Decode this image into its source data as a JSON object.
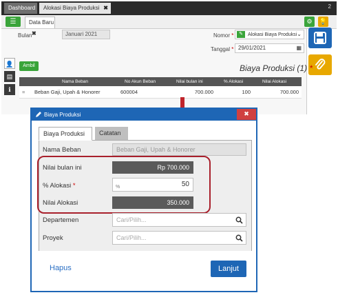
{
  "tabs": {
    "dashboard": "Dashboard",
    "active": "Alokasi Biaya Produksi",
    "close": "✖",
    "counter": "2"
  },
  "subbar": {
    "tab_label": "Data Baru",
    "close": "✖"
  },
  "form": {
    "bulan_label": "Bulan",
    "bulan_value": "Januari 2021",
    "nomor_label": "Nomor",
    "nomor_value": "Alokasi Biaya Produksi",
    "tanggal_label": "Tanggal",
    "tanggal_value": "29/01/2021",
    "add_button": "Ambil",
    "section_title": "Biaya Produksi (1)",
    "required_mark": "*"
  },
  "grid": {
    "headers": [
      "Nama Beban",
      "No Akun Beban",
      "Nilai bulan ini",
      "% Alokasi",
      "Nilai Alokasi"
    ],
    "rows": [
      {
        "nama": "Beban Gaji, Upah & Honorer",
        "akun": "600004",
        "nilai": "700.000",
        "alokasi": "100",
        "nilai_alokasi": "700.000"
      }
    ]
  },
  "dialog": {
    "title": "Biaya Produksi",
    "close": "✖",
    "tab_active": "Biaya Produksi",
    "tab_other": "Catatan",
    "nama_beban_label": "Nama Beban",
    "nama_beban_value": "Beban Gaji, Upah & Honorer",
    "nilai_bulan_label": "Nilai bulan ini",
    "nilai_bulan_value": "Rp 700.000",
    "alokasi_label": "% Alokasi",
    "alokasi_required": "*",
    "alokasi_prefix": "%",
    "alokasi_value": "50",
    "nilai_alokasi_label": "Nilai Alokasi",
    "nilai_alokasi_value": "350.000",
    "departemen_label": "Departemen",
    "departemen_placeholder": "Cari/Pilih...",
    "proyek_label": "Proyek",
    "proyek_placeholder": "Cari/Pilih...",
    "hapus_button": "Hapus",
    "lanjut_button": "Lanjut"
  },
  "colors": {
    "primary": "#1e66b5",
    "success": "#3aa43a",
    "warning": "#e8a800",
    "highlight": "#a81f2b",
    "danger": "#d04040"
  }
}
